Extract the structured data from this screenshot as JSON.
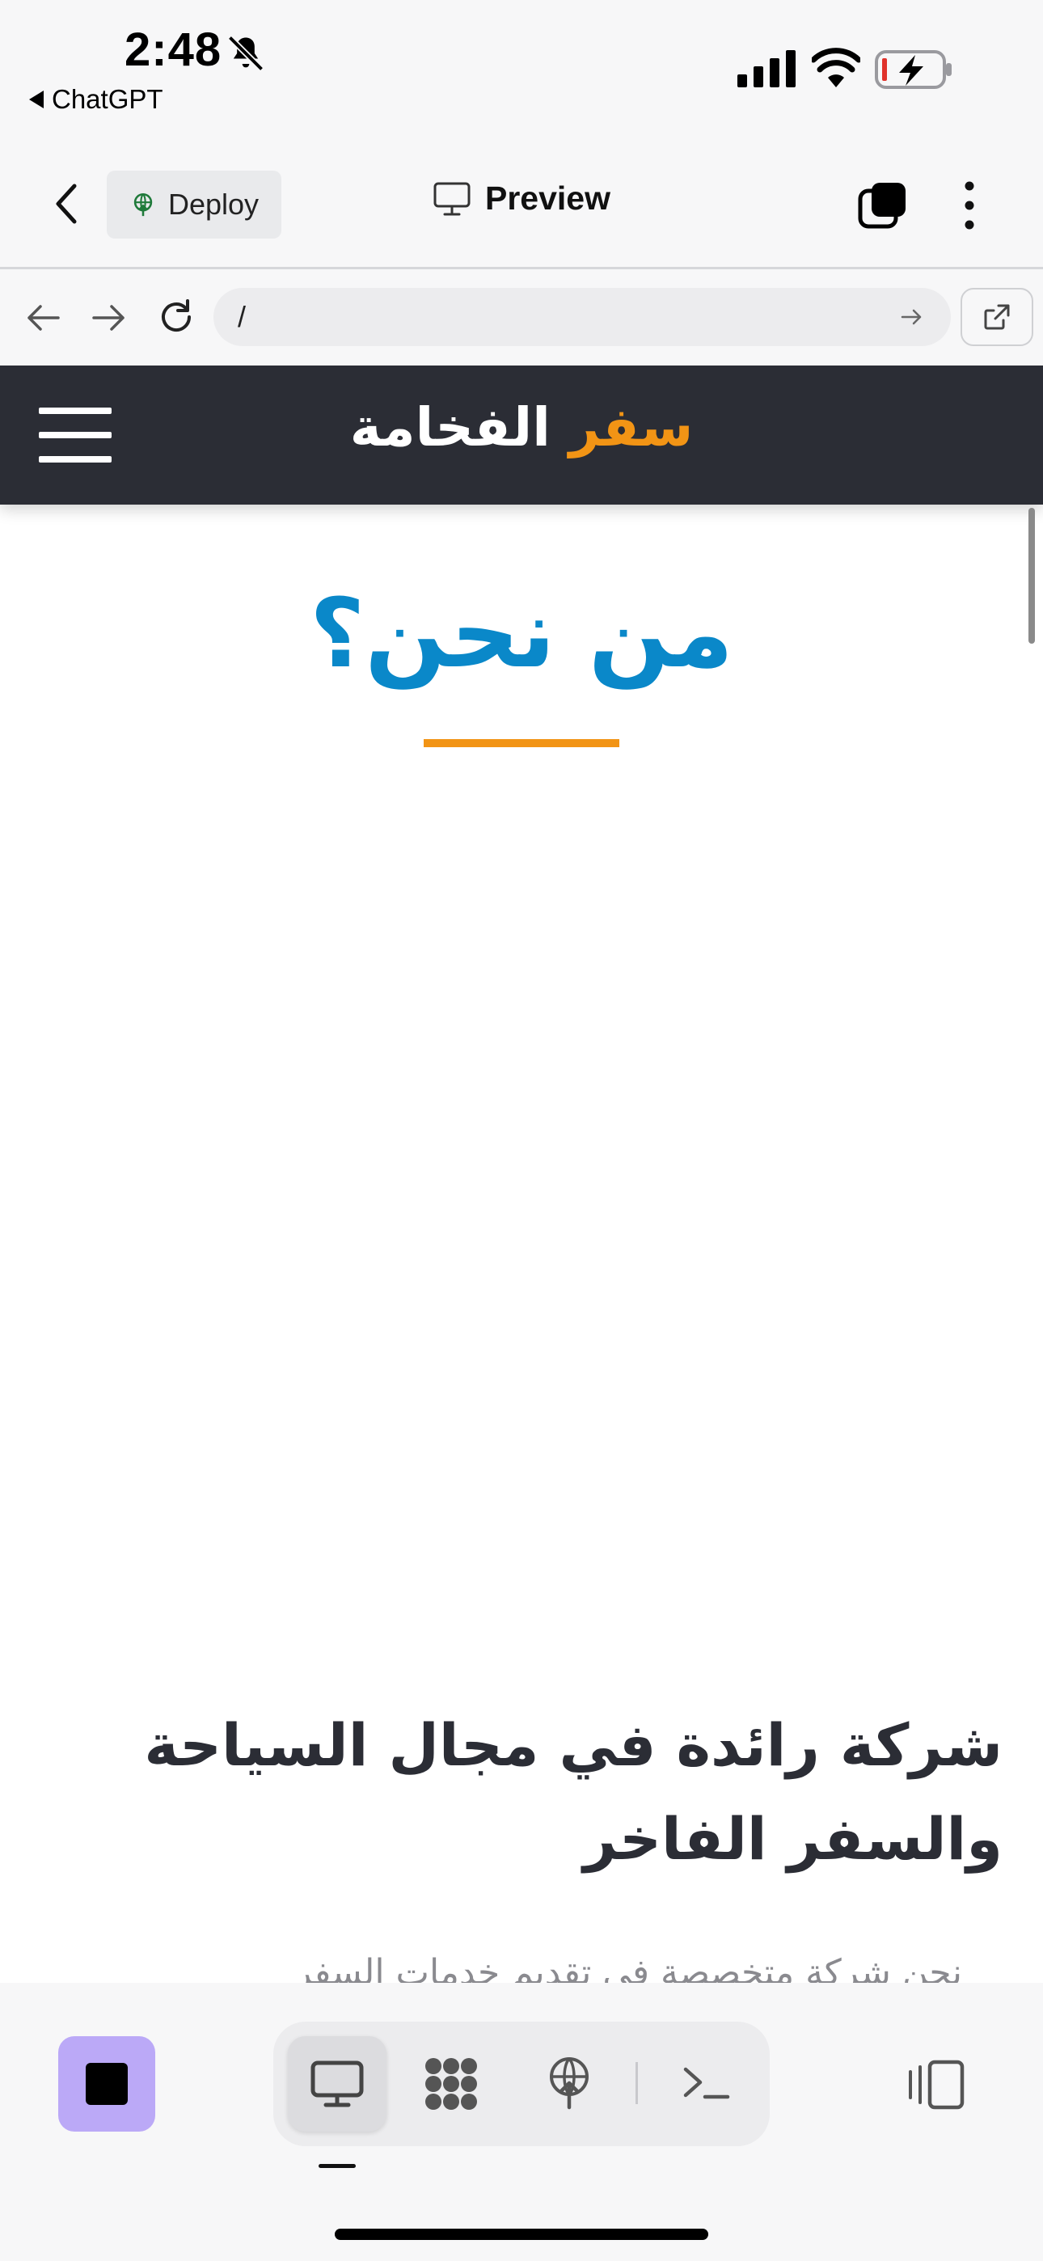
{
  "status_bar": {
    "time": "2:48",
    "back_app": "ChatGPT"
  },
  "header": {
    "deploy_label": "Deploy",
    "title": "Preview"
  },
  "url_bar": {
    "url": "/"
  },
  "site": {
    "brand_accent": "سفر",
    "brand_main": "الفخامة",
    "section_title": "من نحن؟",
    "headline_line1": "شركة رائدة في مجال السياحة",
    "headline_line2": "والسفر الفاخر",
    "body_peek": "نحن شركة متخصصة في تقديم خدمات السفر"
  },
  "colors": {
    "accent_orange": "#f29415",
    "title_blue": "#0a88c9",
    "nav_dark": "#2b2d35",
    "stop_purple": "#bba9f7"
  },
  "toolbar": {
    "segments": [
      "desktop-icon",
      "grid-icon",
      "deploy-icon",
      "terminal-icon"
    ],
    "active_segment": "desktop-icon"
  }
}
